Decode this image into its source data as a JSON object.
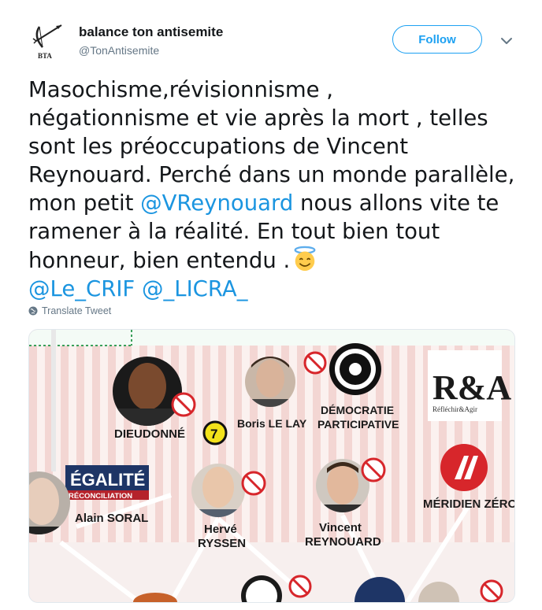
{
  "author": {
    "name": "balance ton antisemite",
    "handle": "@TonAntisemite",
    "avatar_text": "BTA"
  },
  "follow_label": "Follow",
  "tweet": {
    "line1": "Masochisme,révisionnisme ,",
    "line2": "négationnisme et vie après la mort , telles",
    "line3": "sont les préoccupations de Vincent",
    "line4": "Reynouard. Perché dans un monde parallèle,",
    "line5_before": "mon petit ",
    "line5_mention": "@VReynouard",
    "line5_after": " nous allons vite te",
    "line6": "ramener à la réalité. En tout bien tout",
    "line7": "honneur, bien entendu .",
    "emoji": "smiling-face-with-halo",
    "mention_crif": "@Le_CRIF",
    "mention_licra": "@_LICRA_"
  },
  "translate_label": "Translate Tweet",
  "media": {
    "labels": {
      "dieudonne": "DIEUDONNÉ",
      "boris": "Boris LE LAY",
      "democratie_1": "DÉMOCRATIE",
      "democratie_2": "PARTICIPATIVE",
      "ra_logo": "R&A",
      "ra_sub": "Réfléchir&Agir",
      "egalite": "ÉGALITÉ",
      "reconciliation": "RÉCONCILIATION",
      "soral": "Alain SORAL",
      "herve_1": "Hervé",
      "herve_2": "RYSSEN",
      "vincent_1": "Vincent",
      "vincent_2": "REYNOUARD",
      "meridien": "MÉRIDIEN ZÉRO",
      "badge_number": "7"
    },
    "colors": {
      "no_sign_red": "#d7262b",
      "background_pink": "#f6e6e3",
      "mention_blue": "#1b95e0"
    }
  }
}
